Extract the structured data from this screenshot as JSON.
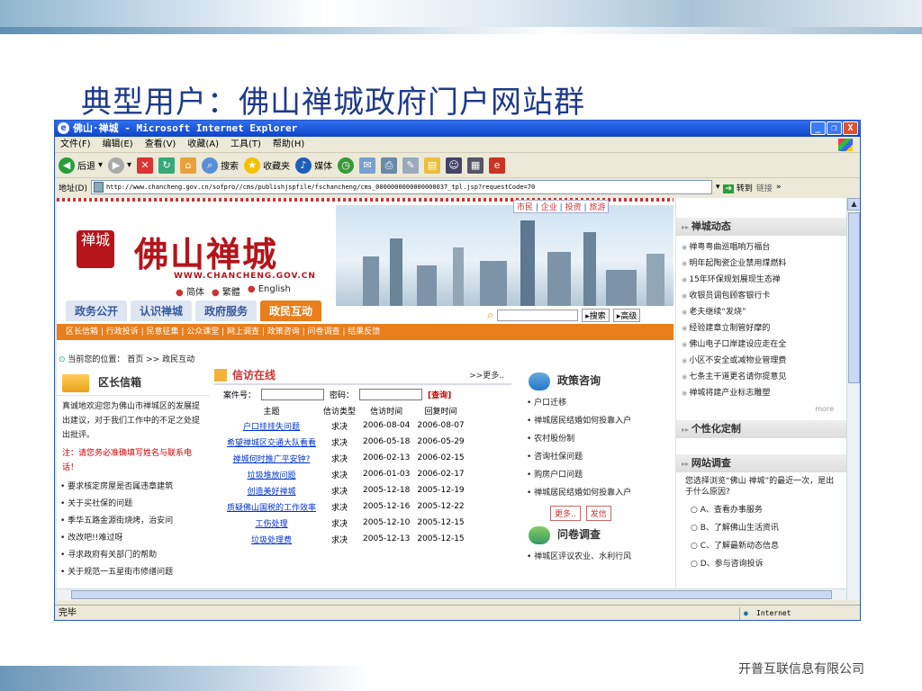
{
  "slide": {
    "title": "典型用户：佛山禅城政府门户网站群",
    "footer": "开普互联信息有限公司"
  },
  "window": {
    "title": "佛山·禅城 - Microsoft Internet Explorer",
    "buttons": [
      "_",
      "❐",
      "X"
    ]
  },
  "menubar": {
    "items": [
      "文件(F)",
      "编辑(E)",
      "查看(V)",
      "收藏(A)",
      "工具(T)",
      "帮助(H)"
    ]
  },
  "toolbar": {
    "back": "后退",
    "search": "搜索",
    "favorites": "收藏夹",
    "media": "媒体"
  },
  "addressbar": {
    "label": "地址(D)",
    "url": "http://www.chancheng.gov.cn/sofpro//cms/publishjspfile/fschancheng/cms_0000000000000000037_tpl.jsp?requestCode=70",
    "go": "转到",
    "links": "链接"
  },
  "status": {
    "text": "完毕",
    "zone": "Internet"
  },
  "site": {
    "logo_seal": "禅城",
    "logo_text": "佛山禅城",
    "logo_url": "WWW.CHANCHENG.GOV.CN",
    "langs": [
      "简体",
      "繁體",
      "English"
    ],
    "toplinks": [
      "市民",
      "企业",
      "投资",
      "旅游"
    ],
    "tabs": [
      "政务公开",
      "认识禅城",
      "政府服务",
      "政民互动"
    ],
    "search_btn": "▸搜索",
    "adv_btn": "▸高级",
    "subnav": "区长信箱 | 行政投诉 | 民意征集 | 公众课堂 | 网上调查 | 政策咨询 | 问卷调查 | 结果反馈",
    "breadcrumb": "当前您的位置： 首页 >> 政民互动"
  },
  "mailbox": {
    "title": "区长信箱",
    "intro": "真诚地欢迎您为佛山市禅城区的发展提出建议，对于我们工作中的不足之处提出批评。",
    "note": "注：请您务必准确填写姓名与联系电话！",
    "items": [
      "要求核定房屋是否属违章建筑",
      "关于买社保的问题",
      "季华五路金源街烧烤，治安问",
      "改改吧!!难过呀",
      "寻求政府有关部门的帮助",
      "关于规范一五星街市修缮问题"
    ]
  },
  "petition": {
    "title": "信访在线",
    "more": ">>更多..",
    "case_label": "案件号：",
    "pwd_label": "密码：",
    "query": "[查询]",
    "headers": [
      "主题",
      "信访类型",
      "信访时间",
      "回复时间"
    ],
    "rows": [
      [
        "户口挂挂失问题",
        "求决",
        "2006-08-04",
        "2006-08-07"
      ],
      [
        "希望禅城区交通大队看看",
        "求决",
        "2006-05-18",
        "2006-05-29"
      ],
      [
        "禅城何时推广平安钟?",
        "求决",
        "2006-02-13",
        "2006-02-15"
      ],
      [
        "垃圾堆放问题",
        "求决",
        "2006-01-03",
        "2006-02-17"
      ],
      [
        "创造美好禅城",
        "求决",
        "2005-12-18",
        "2005-12-19"
      ],
      [
        "质疑佛山国税的工作效率",
        "求决",
        "2005-12-16",
        "2005-12-22"
      ],
      [
        "工伤处理",
        "求决",
        "2005-12-10",
        "2005-12-15"
      ],
      [
        "垃圾处理费",
        "求决",
        "2005-12-13",
        "2005-12-15"
      ]
    ]
  },
  "policy": {
    "title": "政策咨询",
    "items": [
      "户口迁移",
      "禅城居民结婚如何投靠入户",
      "农村股份制",
      "咨询社保问题",
      "购房户口问题",
      "禅城居民结婚如何投靠入户"
    ],
    "more": "更多..",
    "letter": "发信",
    "survey_title": "问卷调查",
    "survey_item": "禅城区评议农业、水利行风"
  },
  "news": {
    "title": "禅城动态",
    "items": [
      "禅粤粤曲巡唱响万福台",
      "明年起陶瓷企业禁用煤燃料",
      "15年环保规划展现生态禅",
      "收银员调包顾客银行卡",
      "老夫继续“发烧”",
      "经验建章立制管好摩的",
      "佛山电子口岸建设应走在全",
      "小区不安全或减物业管理费",
      "七条主干道更名请你提意见",
      "禅城将建产业标志雕塑"
    ],
    "more": "more"
  },
  "custom": {
    "title": "个性化定制"
  },
  "survey": {
    "title": "网站调查",
    "question": "您选择浏览“佛山 禅城”的最近一次，是出于什么原因?",
    "options": [
      "A、查看办事服务",
      "B、了解佛山生活资讯",
      "C、了解最新动态信息",
      "D、参与咨询投诉"
    ]
  },
  "colors": {
    "accent": "#e87e1c",
    "brand_red": "#b5141a",
    "title_blue": "#1f3a8a"
  }
}
